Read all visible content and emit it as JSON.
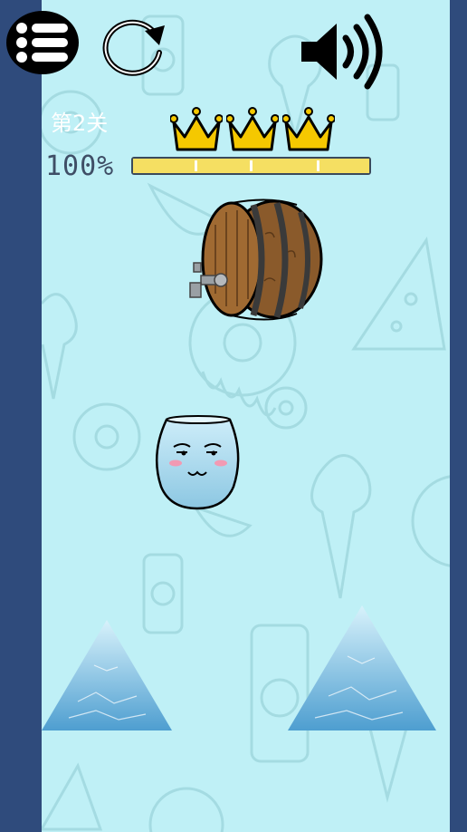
{
  "hud": {
    "level_label": "第2关",
    "percent_label": "100%",
    "progress_value": 1.0,
    "stars_earned": 3,
    "stars_total": 3
  },
  "icons": {
    "menu": "menu-list-icon",
    "restart": "restart-icon",
    "sound": "sound-on-icon",
    "crown": "crown-icon"
  },
  "colors": {
    "side_bars": "#2f4b7c",
    "playfield": "#bff0f6",
    "progress": "#f5df62",
    "crown": "#f5c800",
    "barrel": "#8a5a2b",
    "cup": "#a9dcef",
    "ice": "#6fb6dc"
  }
}
